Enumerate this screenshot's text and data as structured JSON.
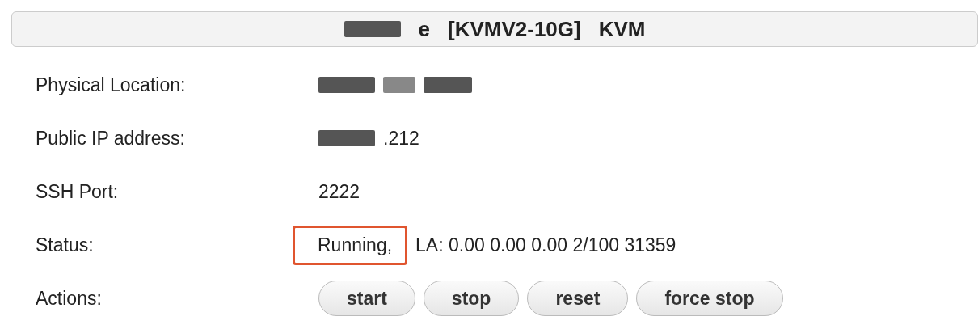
{
  "title": {
    "prefix_visible": "e",
    "plan": "[KVMV2-10G]",
    "type": "KVM"
  },
  "rows": [
    {
      "kind": "redacted",
      "label": "Physical Location:"
    },
    {
      "kind": "partly_redacted",
      "label": "Public IP address:",
      "value": ".212"
    },
    {
      "kind": "text",
      "label": "SSH Port:",
      "value": "2222"
    },
    {
      "kind": "status",
      "label": "Status:",
      "state": "Running,",
      "value": "LA: 0.00 0.00 0.00 2/100 31359"
    },
    {
      "kind": "actions",
      "label": "Actions:",
      "buttons": [
        "start",
        "stop",
        "reset",
        "force stop"
      ]
    }
  ]
}
